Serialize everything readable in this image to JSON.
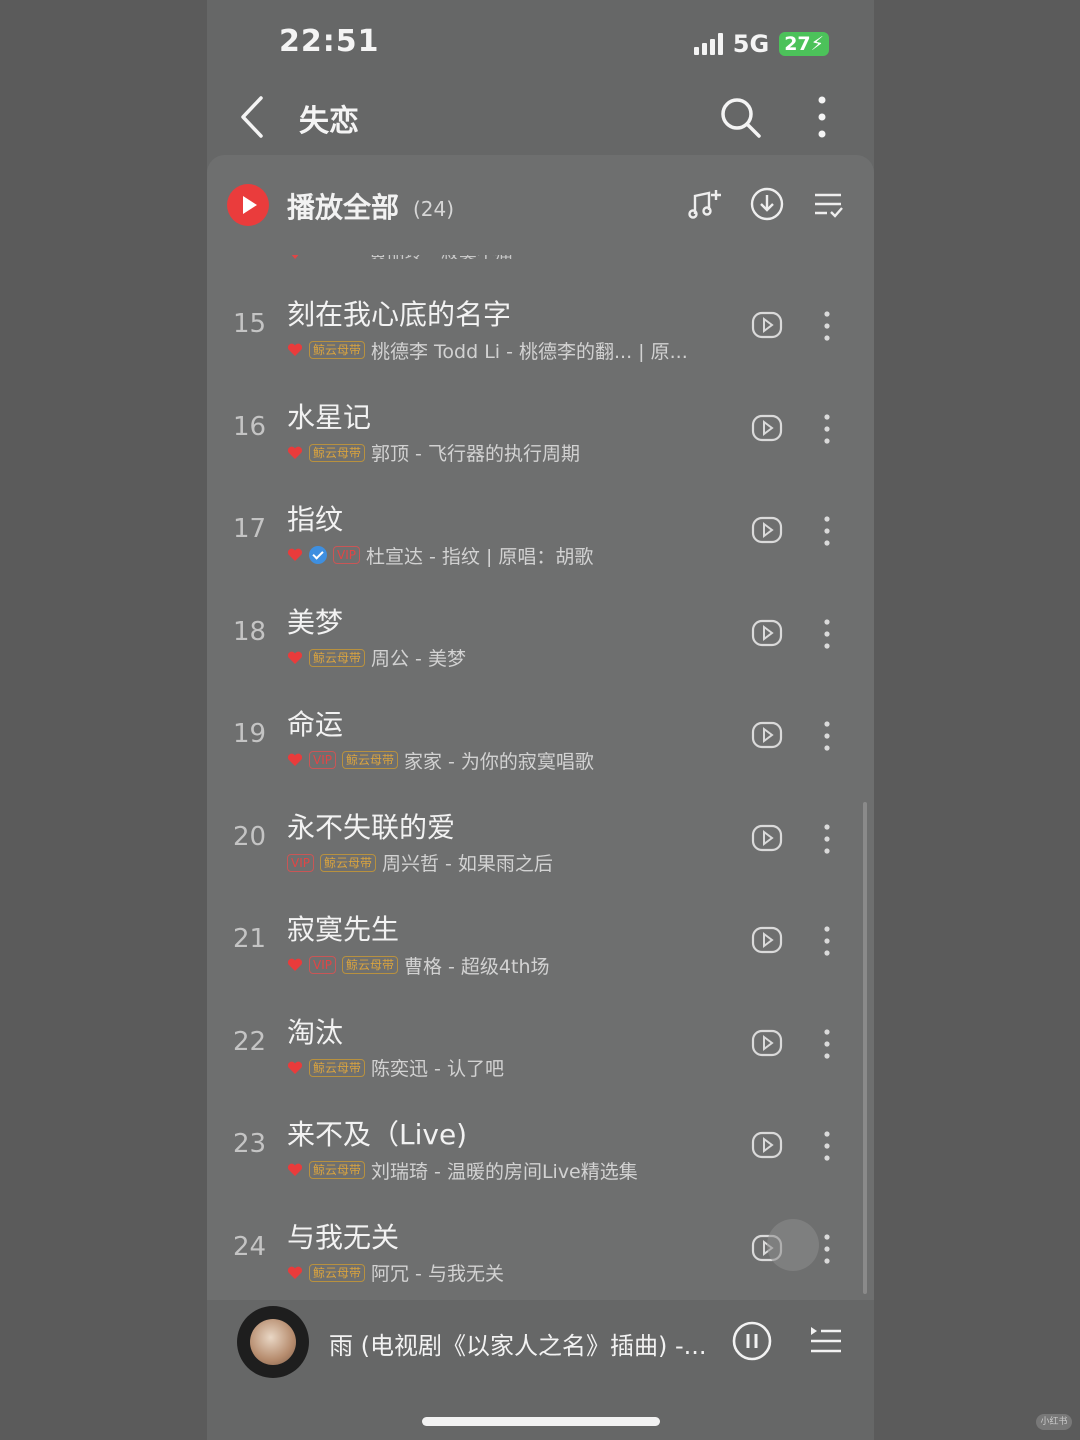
{
  "status_bar": {
    "time": "22:51",
    "network": "5G",
    "battery": "27"
  },
  "header": {
    "title": "失恋"
  },
  "play_all": {
    "label": "播放全部",
    "count": "(24)"
  },
  "partial_row_text": "黄丽玲 - 寂寞不痛",
  "tags": {
    "vip": "VIP",
    "whale": "鲸云母带"
  },
  "songs": [
    {
      "num": "15",
      "title": "刻在我心底的名字",
      "subtitle": "桃德李 Todd Li - 桃德李的翻... | 原..."
    },
    {
      "num": "16",
      "title": "水星记",
      "subtitle": "郭顶 - 飞行器的执行周期"
    },
    {
      "num": "17",
      "title": "指纹",
      "subtitle": "杜宣达 - 指纹 | 原唱：胡歌"
    },
    {
      "num": "18",
      "title": "美梦",
      "subtitle": "周公 - 美梦"
    },
    {
      "num": "19",
      "title": "命运",
      "subtitle": "家家 - 为你的寂寞唱歌"
    },
    {
      "num": "20",
      "title": "永不失联的爱",
      "subtitle": "周兴哲 - 如果雨之后"
    },
    {
      "num": "21",
      "title": "寂寞先生",
      "subtitle": "曹格 - 超级4th场"
    },
    {
      "num": "22",
      "title": "淘汰",
      "subtitle": "陈奕迅 - 认了吧"
    },
    {
      "num": "23",
      "title": "来不及（Live)",
      "subtitle": "刘瑞琦 - 温暖的房间Live精选集"
    },
    {
      "num": "24",
      "title": "与我无关",
      "subtitle": "阿冗 - 与我无关"
    }
  ],
  "now_playing": {
    "title": "雨 (电视剧《以家人之名》插曲) -..."
  },
  "watermark": "小红书",
  "colors": {
    "accent": "#ea3c3c",
    "vip": "#e04646",
    "whale_tag": "#d9a33f",
    "verified": "#3e8fe0",
    "battery": "#4cc25a"
  },
  "icons": [
    "back-icon",
    "search-icon",
    "more-icon",
    "play-all-icon",
    "add-music-icon",
    "download-icon",
    "multi-select-icon",
    "heart-icon",
    "verified-icon",
    "play-video-icon",
    "pause-icon",
    "playlist-icon"
  ]
}
